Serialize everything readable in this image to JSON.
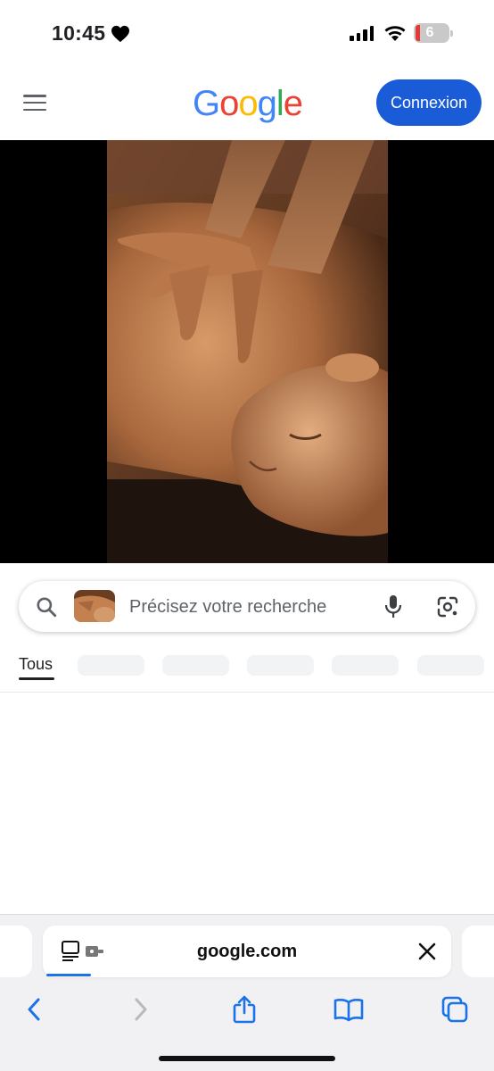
{
  "status_bar": {
    "time": "10:45",
    "battery": "6",
    "icons": [
      "heart-icon",
      "signal-icon",
      "wifi-icon",
      "battery-icon"
    ]
  },
  "header": {
    "logo": "Google",
    "logo_colors": [
      "#4285F4",
      "#EA4335",
      "#FBBC05",
      "#4285F4",
      "#34A853",
      "#EA4335"
    ],
    "signin_label": "Connexion",
    "accent": "#1A5BD7"
  },
  "search": {
    "placeholder": "Précisez votre recherche",
    "icons": [
      "search-icon",
      "image-thumbnail",
      "mic-icon",
      "lens-icon"
    ]
  },
  "tabs": {
    "active": "Tous"
  },
  "safari": {
    "url": "google.com",
    "toolbar": [
      "back-icon",
      "forward-icon",
      "share-icon",
      "bookmarks-icon",
      "tabs-icon"
    ],
    "link_color": "#1A73E8"
  }
}
